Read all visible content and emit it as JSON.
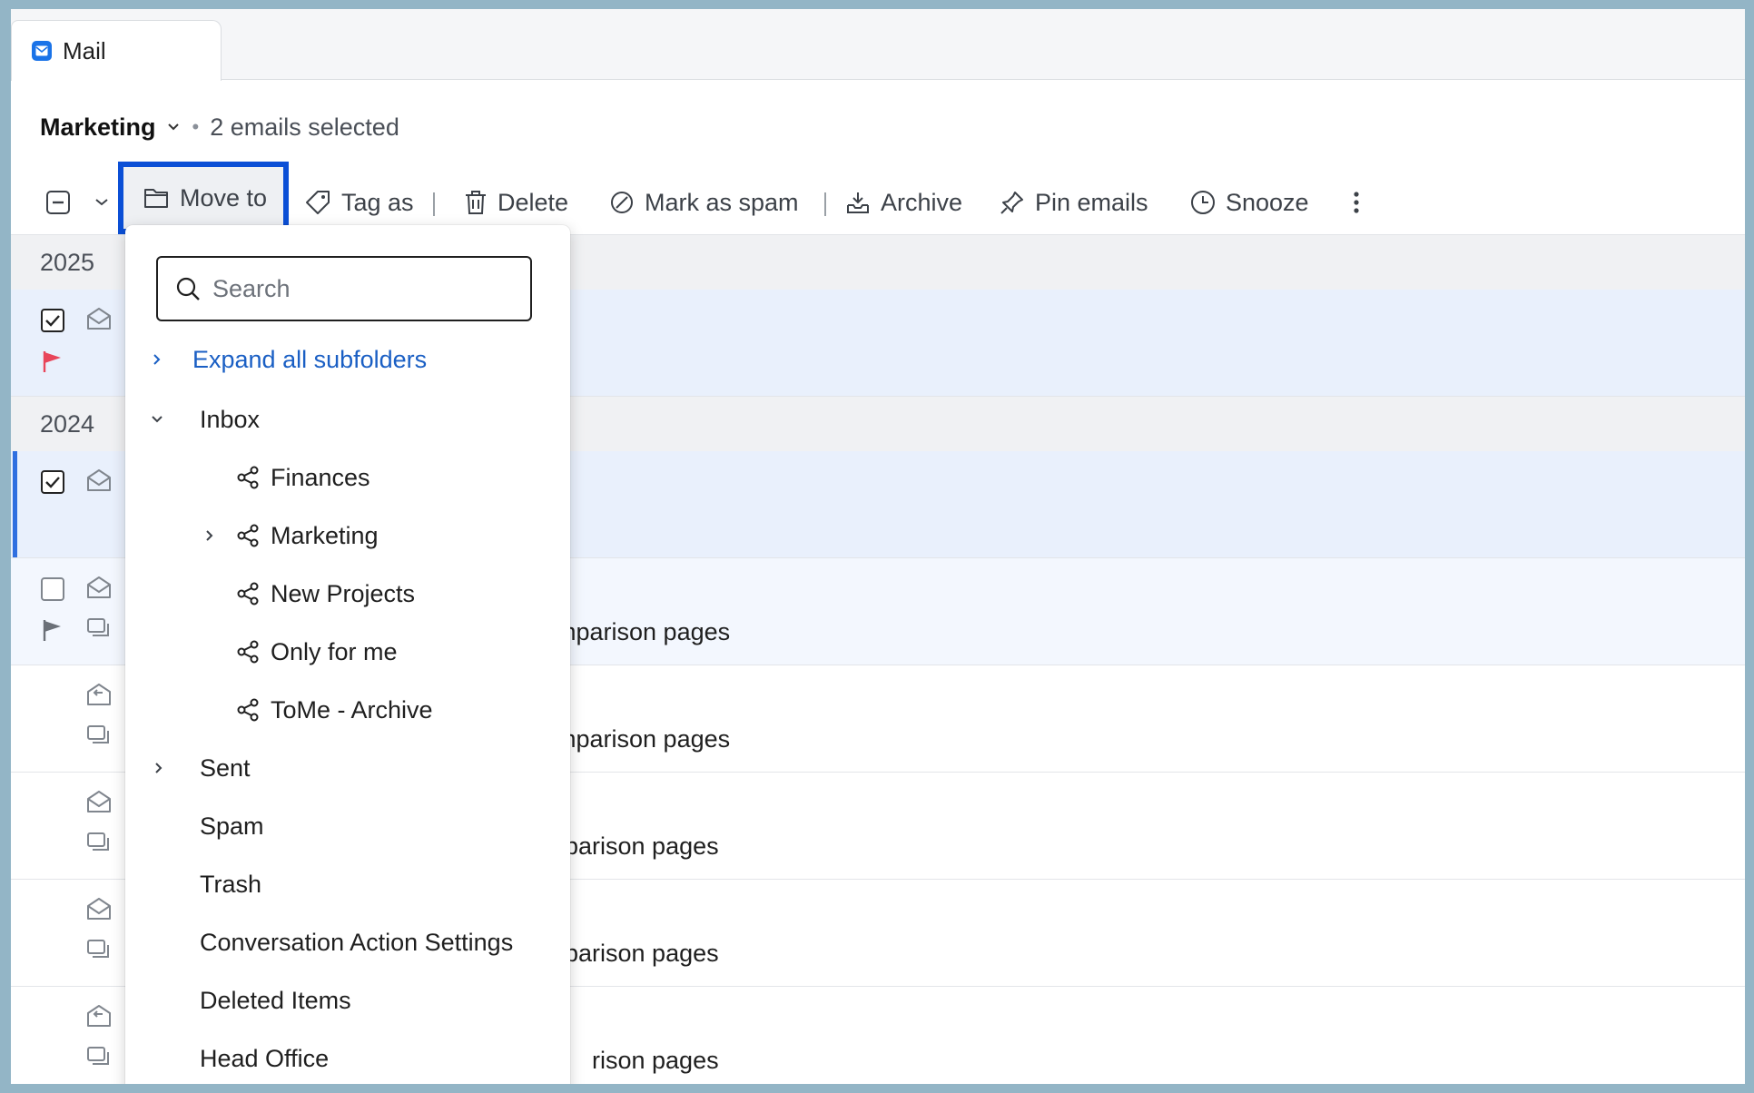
{
  "tab": {
    "label": "Mail"
  },
  "header": {
    "folder": "Marketing",
    "separator": "•",
    "selected_count": "2 emails selected"
  },
  "toolbar": {
    "move_to": "Move to",
    "tag_as": "Tag as",
    "delete": "Delete",
    "mark_as_spam": "Mark as spam",
    "archive": "Archive",
    "pin_emails": "Pin emails",
    "snooze": "Snooze"
  },
  "list": {
    "groups": [
      "2025",
      "2024"
    ],
    "subject_fragments": [
      "mparison pages",
      "mparison pages",
      "parison pages",
      "parison pages",
      "rison pages"
    ]
  },
  "move_menu": {
    "search_placeholder": "Search",
    "expand_all": "Expand all subfolders",
    "folders": [
      "Inbox",
      "Finances",
      "Marketing",
      "New Projects",
      "Only for me",
      "ToMe - Archive",
      "Sent",
      "Spam",
      "Trash",
      "Conversation Action Settings",
      "Deleted Items",
      "Head Office"
    ]
  },
  "colors": {
    "accent": "#0b4fd6",
    "link": "#1a5fc4",
    "flag_red": "#e8455a",
    "selected_row": "#e9f0fc"
  }
}
